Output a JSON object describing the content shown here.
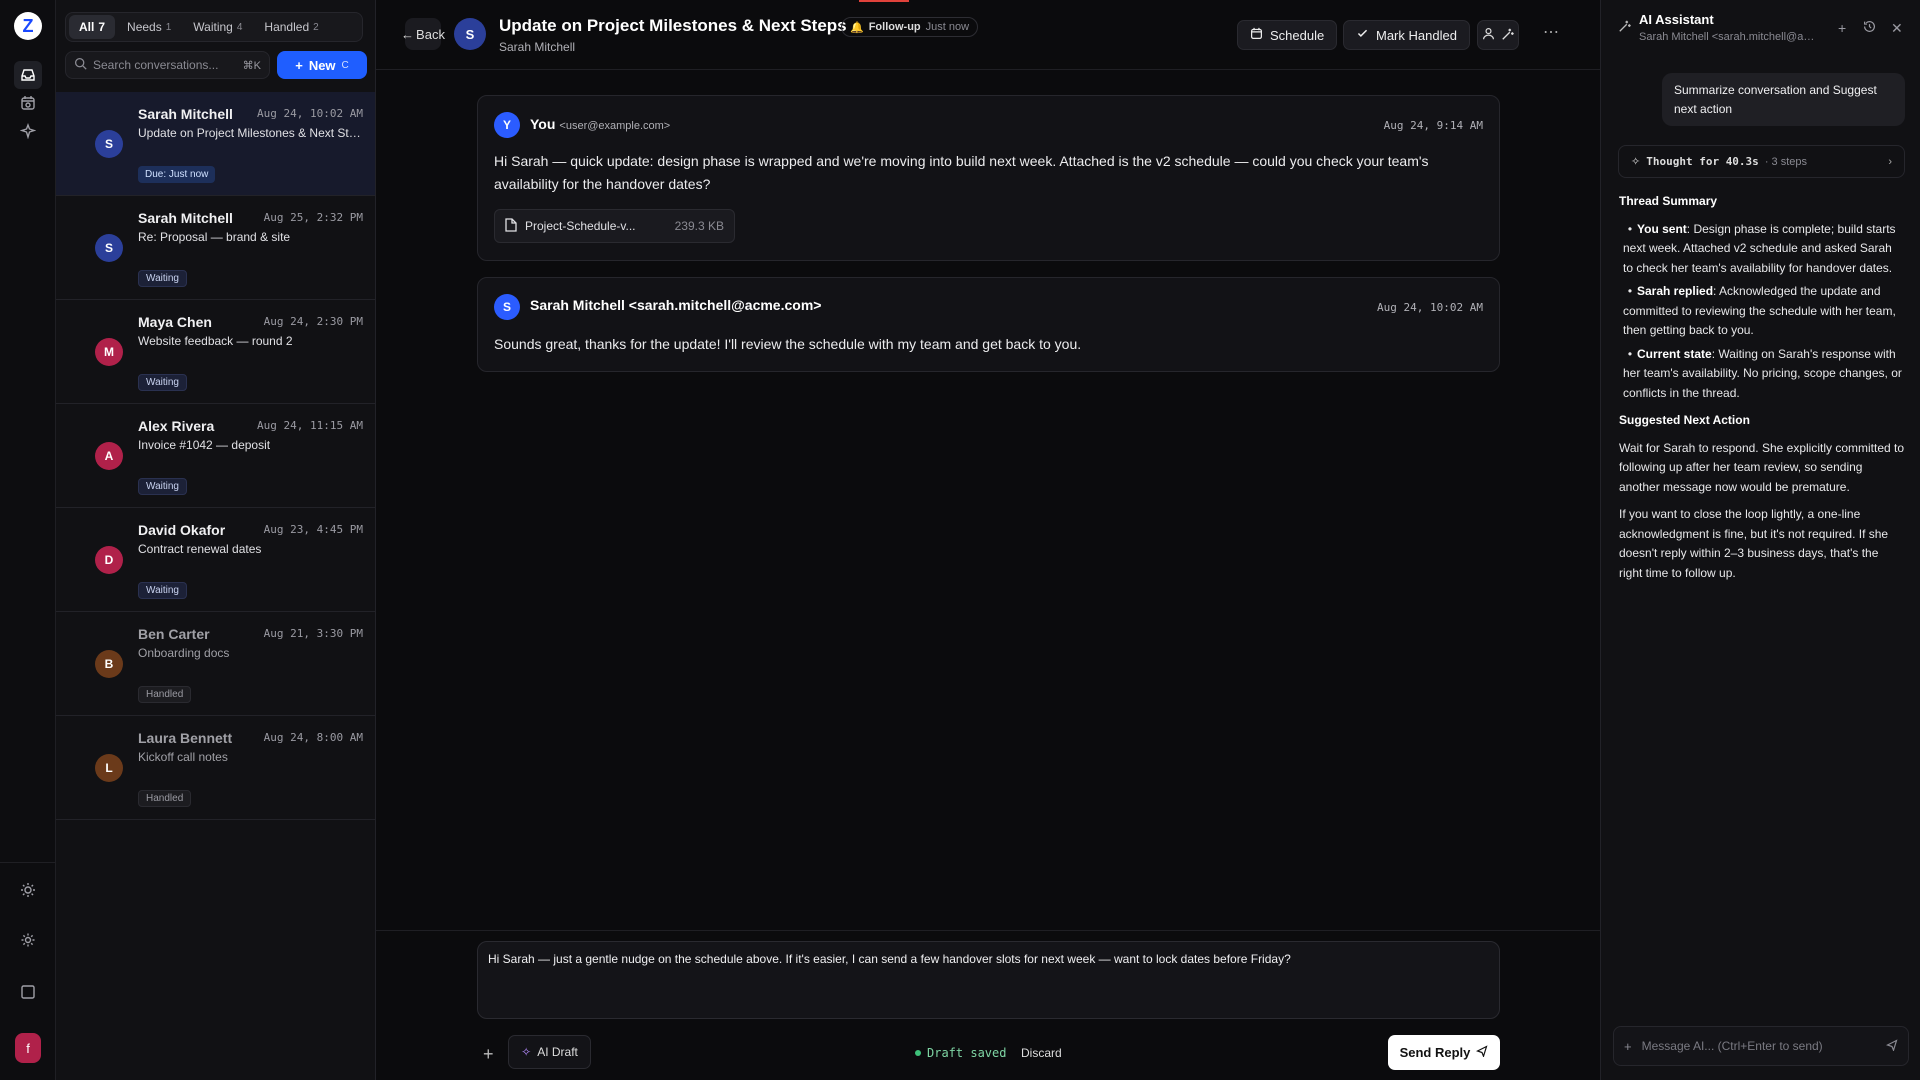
{
  "rail": {
    "logo_letter": "Z",
    "avatar_letter": "f"
  },
  "tabs": [
    {
      "label": "All",
      "count": "7"
    },
    {
      "label": "Needs",
      "count": "1"
    },
    {
      "label": "Waiting",
      "count": "4"
    },
    {
      "label": "Handled",
      "count": "2"
    }
  ],
  "search": {
    "placeholder": "Search conversations...",
    "shortcut": "⌘K"
  },
  "new_button": {
    "label": "New",
    "shortcut": "C"
  },
  "conversations": [
    {
      "initial": "S",
      "name": "Sarah Mitchell",
      "date": "Aug 24, 10:02 AM",
      "subject": "Update on Project Milestones & Next Steps",
      "badge": "Due: Just now",
      "color": "#2b3f9a"
    },
    {
      "initial": "S",
      "name": "Sarah Mitchell",
      "date": "Aug 25, 2:32 PM",
      "subject": "Re: Proposal — brand & site",
      "badge": "Waiting",
      "color": "#2b3f9a"
    },
    {
      "initial": "M",
      "name": "Maya Chen",
      "date": "Aug 24, 2:30 PM",
      "subject": "Website feedback — round 2",
      "badge": "Waiting",
      "color": "#b0214a"
    },
    {
      "initial": "A",
      "name": "Alex Rivera",
      "date": "Aug 24, 11:15 AM",
      "subject": "Invoice #1042 — deposit",
      "badge": "Waiting",
      "color": "#b0214a"
    },
    {
      "initial": "D",
      "name": "David Okafor",
      "date": "Aug 23, 4:45 PM",
      "subject": "Contract renewal dates",
      "badge": "Waiting",
      "color": "#b0214a"
    },
    {
      "initial": "B",
      "name": "Ben Carter",
      "date": "Aug 21, 3:30 PM",
      "subject": "Onboarding docs",
      "badge": "Handled",
      "color": "#6b3a1a"
    },
    {
      "initial": "L",
      "name": "Laura Bennett",
      "date": "Aug 24, 8:00 AM",
      "subject": "Kickoff call notes",
      "badge": "Handled",
      "color": "#6b3a1a"
    }
  ],
  "header": {
    "back": "Back",
    "avatar": "S",
    "title": "Update on Project Milestones & Next Steps",
    "subtitle": "Sarah Mitchell",
    "followup_label": "Follow-up",
    "followup_time": "Just now",
    "schedule": "Schedule",
    "mark_handled": "Mark Handled"
  },
  "messages": [
    {
      "initial": "Y",
      "from": "You",
      "address": "<user@example.com>",
      "date": "Aug 24, 9:14 AM",
      "body": "Hi Sarah — quick update: design phase is wrapped and we're moving into build next week. Attached is the v2 schedule — could you check your team's availability for the handover dates?",
      "attachment": {
        "name": "Project-Schedule-v...",
        "size": "239.3 KB"
      }
    },
    {
      "initial": "S",
      "from": "Sarah Mitchell <sarah.mitchell@acme.com>",
      "address": "",
      "date": "Aug 24, 10:02 AM",
      "body": "Sounds great, thanks for the update! I'll review the schedule with my team and get back to you."
    }
  ],
  "composer": {
    "draft": "Hi Sarah — just a gentle nudge on the schedule above. If it's easier, I can send a few handover slots for next week — want to lock dates before Friday?",
    "ai_draft": "AI Draft",
    "saved": "Draft saved",
    "discard": "Discard",
    "send": "Send Reply"
  },
  "ai": {
    "title": "AI Assistant",
    "subtitle": "Sarah Mitchell <sarah.mitchell@acme.com>",
    "user_query": "Summarize conversation and Suggest next action",
    "thought_label": "Thought for 40.3s",
    "thought_steps": "· 3 steps",
    "summary_heading": "Thread Summary",
    "bullets": [
      {
        "lead": "You sent",
        "text": ": Design phase is complete; build starts next week. Attached v2 schedule and asked Sarah to check her team's availability for handover dates."
      },
      {
        "lead": "Sarah replied",
        "text": ": Acknowledged the update and committed to reviewing the schedule with her team, then getting back to you."
      },
      {
        "lead": "Current state",
        "text": ": Waiting on Sarah's response with her team's availability. No pricing, scope changes, or conflicts in the thread."
      }
    ],
    "next_heading": "Suggested Next Action",
    "para1": "Wait for Sarah to respond. She explicitly committed to following up after her team review, so sending another message now would be premature.",
    "para2": "If you want to close the loop lightly, a one-line acknowledgment is fine, but it's not required. If she doesn't reply within 2–3 business days, that's the right time to follow up.",
    "input_placeholder": "Message AI... (Ctrl+Enter to send)"
  }
}
